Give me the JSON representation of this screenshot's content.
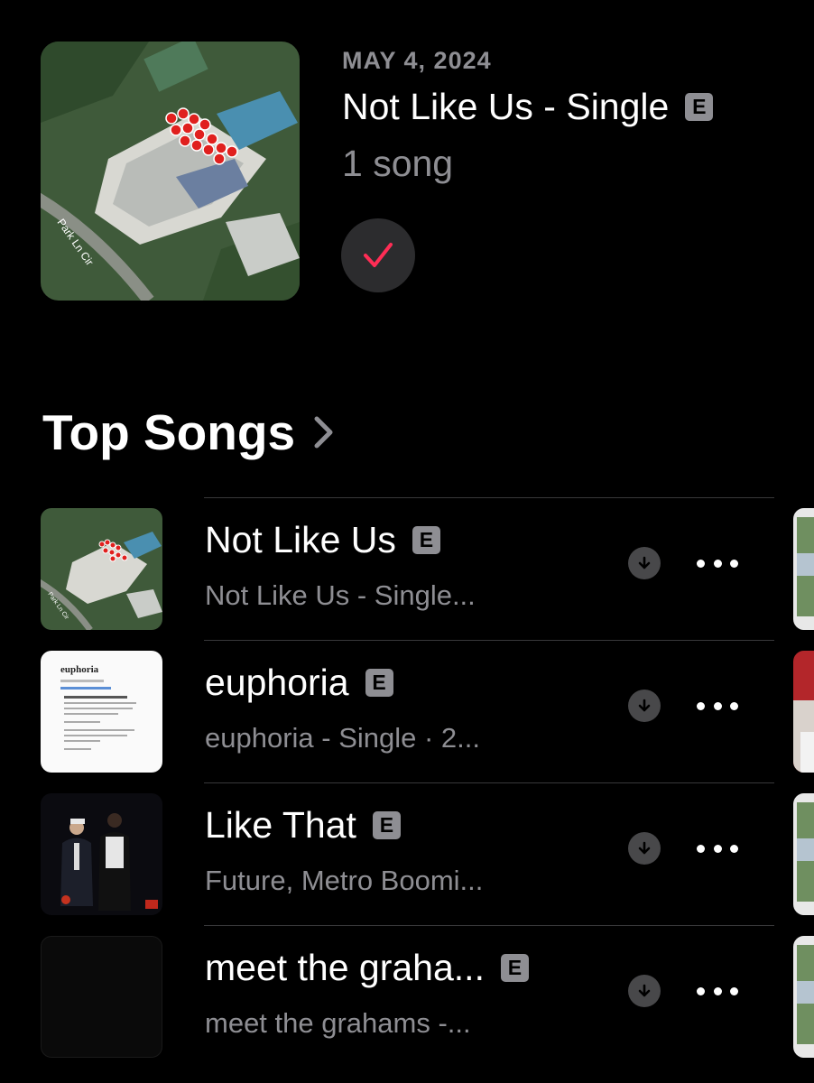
{
  "latest_release": {
    "date": "MAY 4, 2024",
    "title": "Not Like Us - Single",
    "explicit_badge": "E",
    "song_count": "1 song",
    "artwork_map_label": "Park Ln Cir",
    "added_icon": "checkmark-icon"
  },
  "top_songs": {
    "heading": "Top Songs",
    "chevron_icon": "chevron-right-icon",
    "rows": [
      {
        "title": "Not Like Us",
        "explicit": "E",
        "subtitle": "Not Like Us - Single...",
        "art": "aerial-map",
        "art_label": "Park Ln Cir"
      },
      {
        "title": "euphoria",
        "explicit": "E",
        "subtitle": "euphoria - Single · 2...",
        "art": "dictionary-page",
        "art_label": "euphoria"
      },
      {
        "title": "Like That",
        "explicit": "E",
        "subtitle": "Future, Metro Boomi...",
        "art": "two-figures-dark",
        "art_label": ""
      },
      {
        "title": "meet the graha...",
        "explicit": "E",
        "subtitle": "meet the grahams -...",
        "art": "black-square",
        "art_label": ""
      }
    ]
  },
  "colors": {
    "background": "#000000",
    "secondary_text": "#8e8e93",
    "accent_check": "#ff2d55",
    "button_bg": "#2c2c2e"
  }
}
